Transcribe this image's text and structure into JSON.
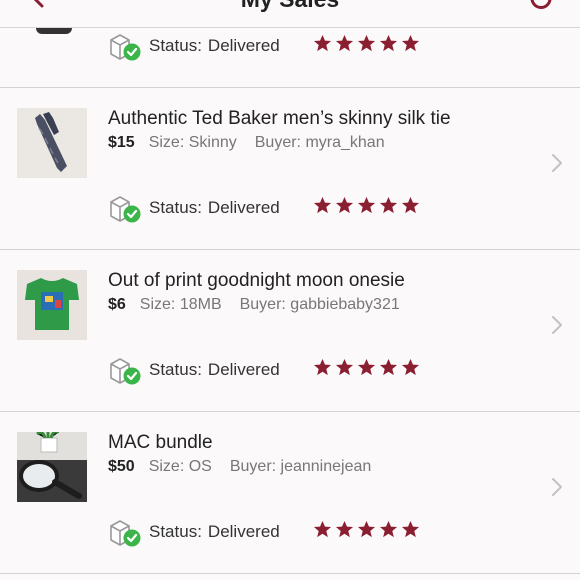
{
  "header": {
    "title": "My Sales"
  },
  "colors": {
    "star": "#8a1f32",
    "check": "#3bb54a",
    "accent": "#8a1f32"
  },
  "first_status": {
    "status_label": "Status:",
    "status_value": "Delivered",
    "rating": 5
  },
  "sales": [
    {
      "title": "Authentic Ted Baker men’s skinny silk tie",
      "price": "$15",
      "size": "Size: Skinny",
      "buyer": "Buyer: myra_khan",
      "status_label": "Status:",
      "status_value": "Delivered",
      "rating": 5,
      "thumb_icon": "tie-photo"
    },
    {
      "title": "Out of print goodnight moon onesie",
      "price": "$6",
      "size": "Size: 18MB",
      "buyer": "Buyer: gabbiebaby321",
      "status_label": "Status:",
      "status_value": "Delivered",
      "rating": 5,
      "thumb_icon": "onesie-photo"
    },
    {
      "title": "MAC bundle",
      "price": "$50",
      "size": "Size: OS",
      "buyer": "Buyer: jeanninejean",
      "status_label": "Status:",
      "status_value": "Delivered",
      "rating": 5,
      "thumb_icon": "mirror-photo"
    }
  ]
}
